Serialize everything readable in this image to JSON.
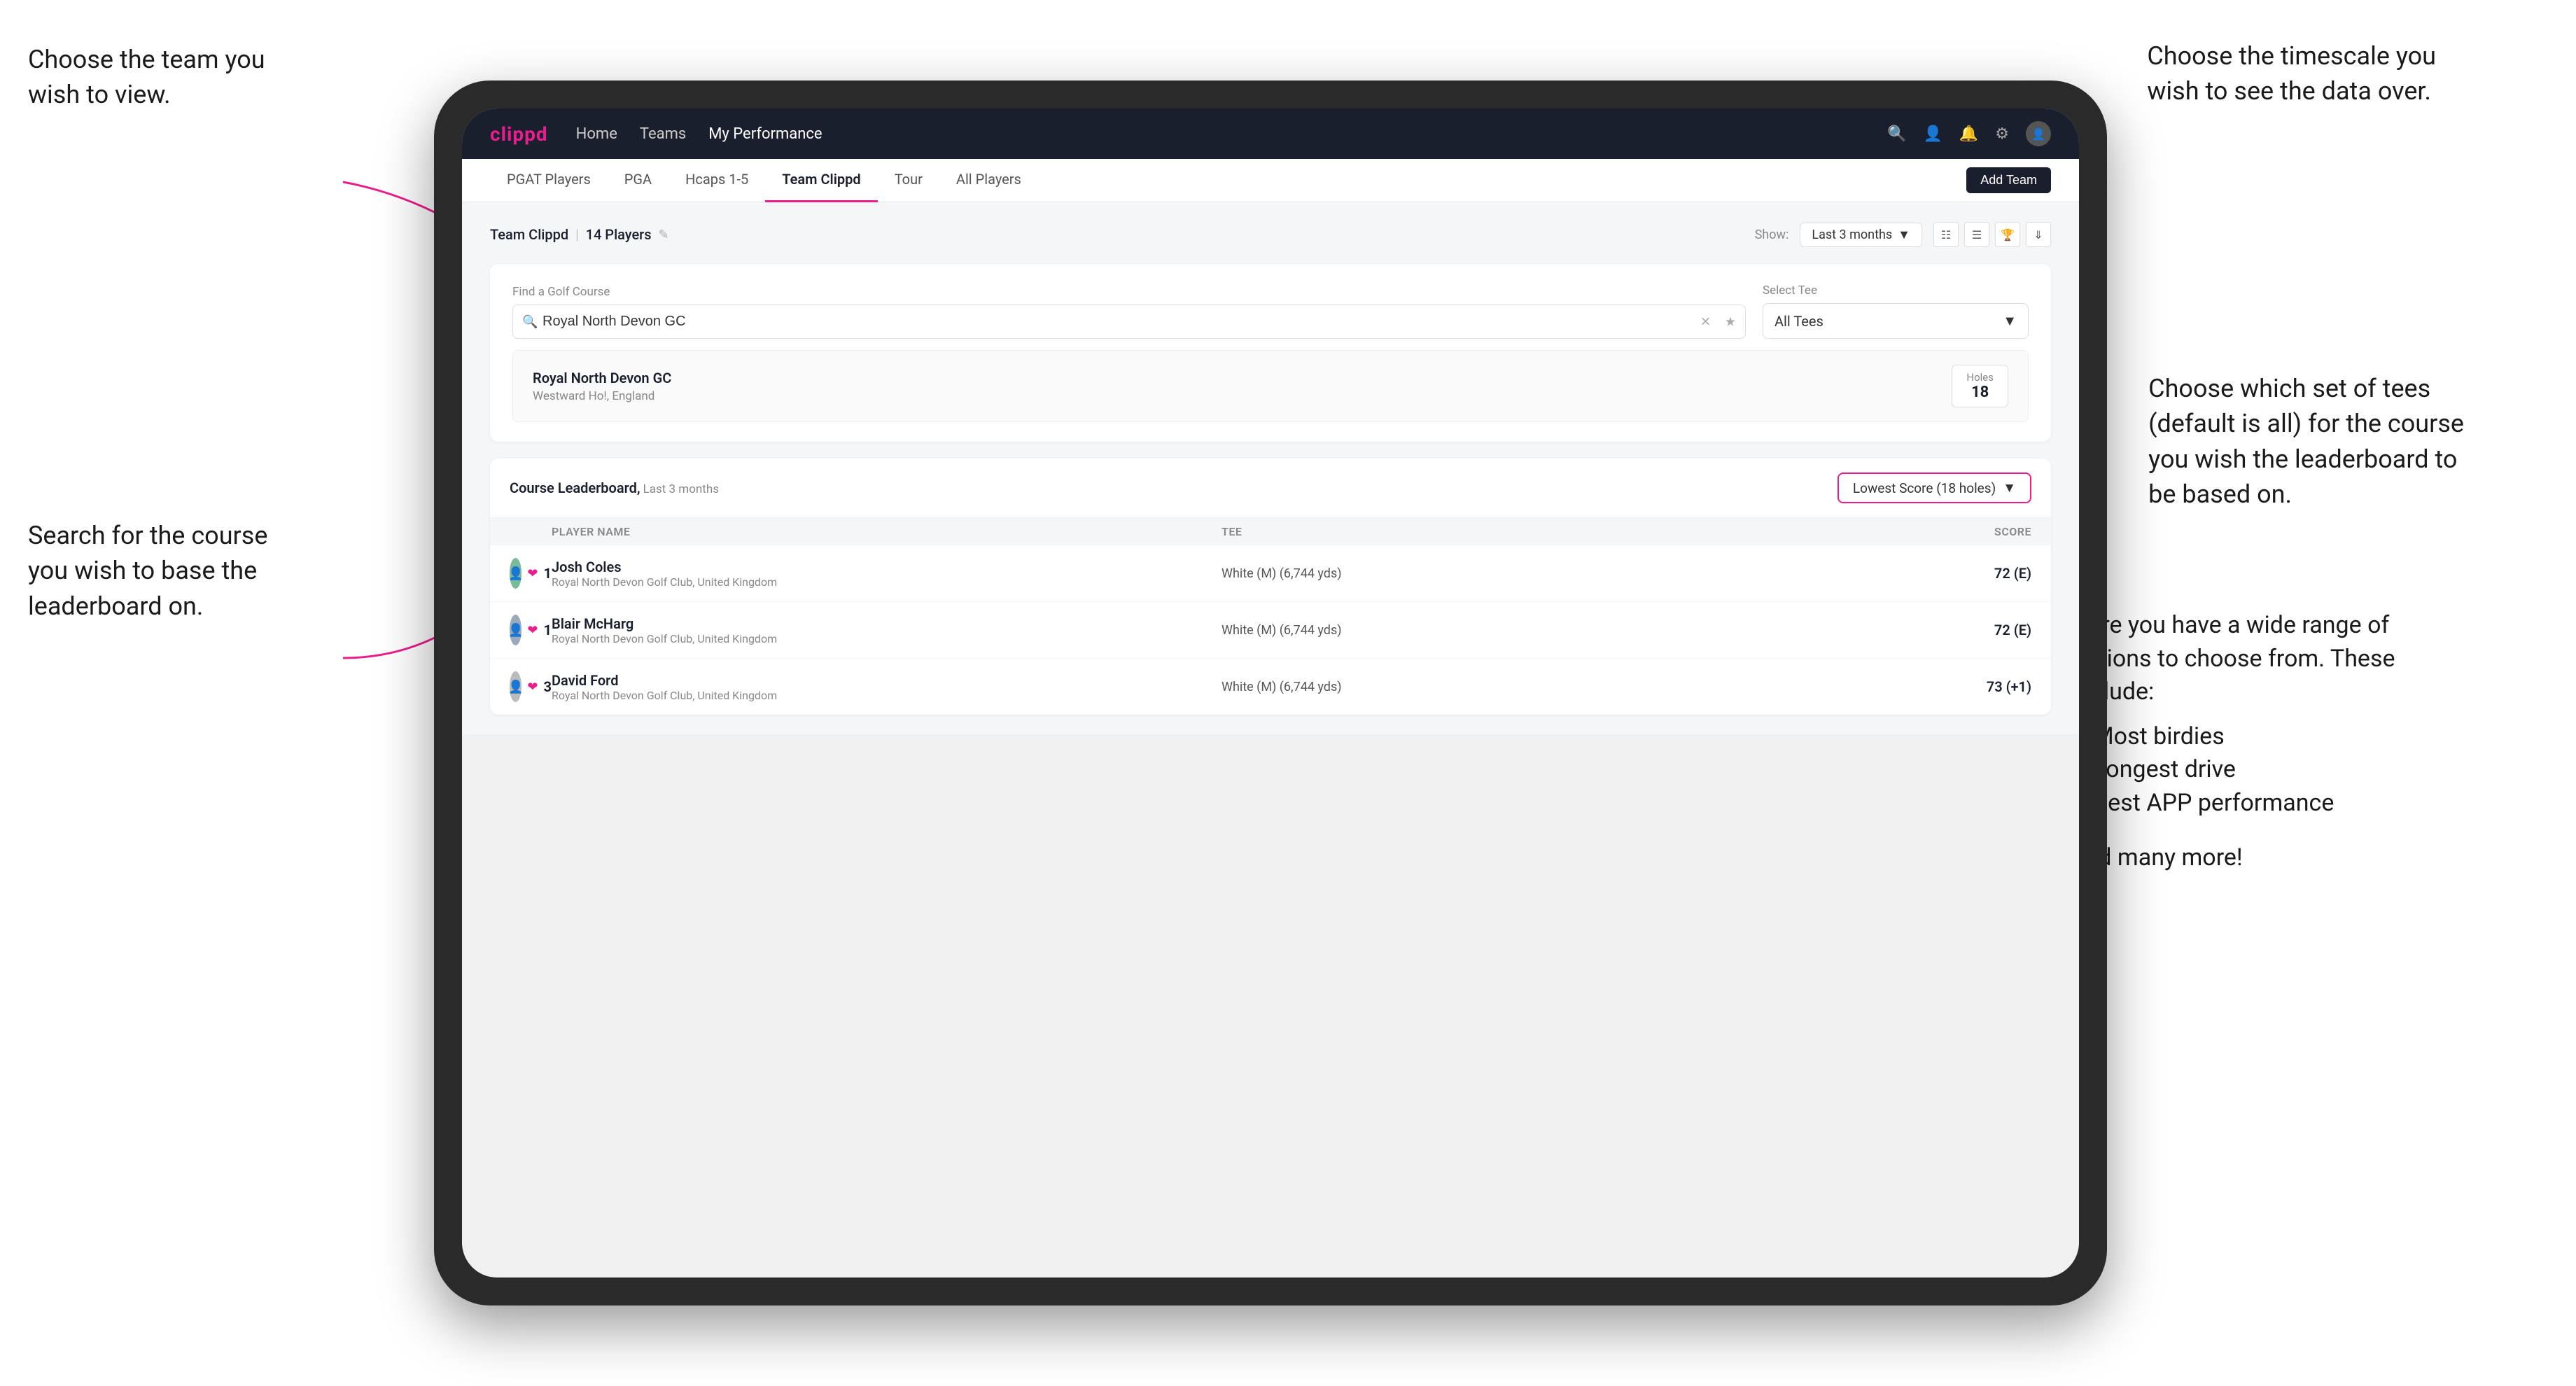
{
  "annotations": {
    "top_left": {
      "title": "Choose the team you wish to view.",
      "line1": "Choose the team you",
      "line2": "wish to view."
    },
    "bottom_left": {
      "line1": "Search for the course",
      "line2": "you wish to base the",
      "line3": "leaderboard on."
    },
    "top_right": {
      "line1": "Choose the timescale you",
      "line2": "wish to see the data over."
    },
    "middle_right": {
      "line1": "Choose which set of tees",
      "line2": "(default is all) for the course",
      "line3": "you wish the leaderboard to",
      "line4": "be based on."
    },
    "bottom_right": {
      "intro": "Here you have a wide range of options to choose from. These include:",
      "bullets": [
        "Most birdies",
        "Longest drive",
        "Best APP performance"
      ],
      "outro": "and many more!"
    }
  },
  "navbar": {
    "logo": "clippd",
    "links": [
      {
        "label": "Home",
        "active": false
      },
      {
        "label": "Teams",
        "active": false
      },
      {
        "label": "My Performance",
        "active": true
      }
    ],
    "icons": [
      "search",
      "person",
      "bell",
      "settings",
      "avatar"
    ]
  },
  "secondary_nav": {
    "items": [
      {
        "label": "PGAT Players",
        "active": false
      },
      {
        "label": "PGA",
        "active": false
      },
      {
        "label": "Hcaps 1-5",
        "active": false
      },
      {
        "label": "Team Clippd",
        "active": true
      },
      {
        "label": "Tour",
        "active": false
      },
      {
        "label": "All Players",
        "active": false
      }
    ],
    "add_team_button": "Add Team"
  },
  "team_header": {
    "team_name": "Team Clippd",
    "player_count": "14 Players",
    "show_label": "Show:",
    "show_value": "Last 3 months",
    "view_icons": [
      "grid",
      "list",
      "trophy",
      "download"
    ]
  },
  "filter": {
    "search_label": "Find a Golf Course",
    "search_placeholder": "Royal North Devon GC",
    "search_value": "Royal North Devon GC",
    "tee_label": "Select Tee",
    "tee_value": "All Tees"
  },
  "course_result": {
    "name": "Royal North Devon GC",
    "location": "Westward Ho!, England",
    "holes_label": "Holes",
    "holes_value": "18"
  },
  "leaderboard": {
    "title": "Course Leaderboard,",
    "subtitle": "Last 3 months",
    "score_dropdown": "Lowest Score (18 holes)",
    "columns": {
      "player_name": "PLAYER NAME",
      "tee": "TEE",
      "score": "SCORE"
    },
    "rows": [
      {
        "rank": "1",
        "name": "Josh Coles",
        "club": "Royal North Devon Golf Club, United Kingdom",
        "tee": "White (M) (6,744 yds)",
        "score": "72 (E)"
      },
      {
        "rank": "1",
        "name": "Blair McHarg",
        "club": "Royal North Devon Golf Club, United Kingdom",
        "tee": "White (M) (6,744 yds)",
        "score": "72 (E)"
      },
      {
        "rank": "3",
        "name": "David Ford",
        "club": "Royal North Devon Golf Club, United Kingdom",
        "tee": "White (M) (6,744 yds)",
        "score": "73 (+1)"
      }
    ]
  },
  "colors": {
    "brand_pink": "#e91e8c",
    "brand_dark": "#1a1f2e",
    "bg_light": "#f5f6f8"
  }
}
